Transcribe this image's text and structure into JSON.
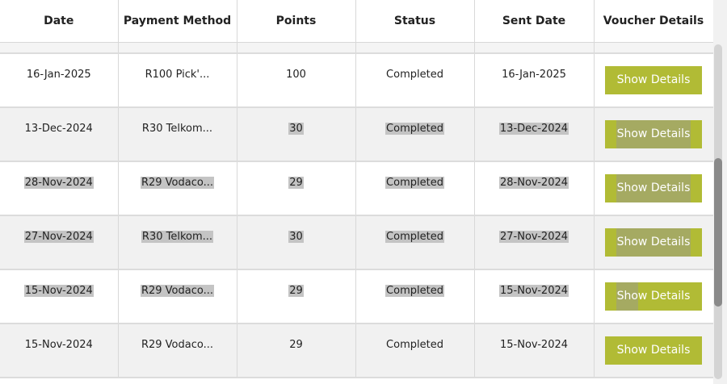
{
  "table": {
    "headers": [
      "Date",
      "Payment Method",
      "Points",
      "Status",
      "Sent Date",
      "Voucher Details"
    ],
    "button_label": "Show Details",
    "rows": [
      {
        "date": "16-Jan-2025",
        "method": "R100 Pick'...",
        "points": "100",
        "status": "Completed",
        "sent": "16-Jan-2025"
      },
      {
        "date": "13-Dec-2024",
        "method": "R30 Telkom...",
        "points": "30",
        "status": "Completed",
        "sent": "13-Dec-2024"
      },
      {
        "date": "28-Nov-2024",
        "method": "R29 Vodaco...",
        "points": "29",
        "status": "Completed",
        "sent": "28-Nov-2024"
      },
      {
        "date": "27-Nov-2024",
        "method": "R30 Telkom...",
        "points": "30",
        "status": "Completed",
        "sent": "27-Nov-2024"
      },
      {
        "date": "15-Nov-2024",
        "method": "R29 Vodaco...",
        "points": "29",
        "status": "Completed",
        "sent": "15-Nov-2024"
      },
      {
        "date": "15-Nov-2024",
        "method": "R29 Vodaco...",
        "points": "29",
        "status": "Completed",
        "sent": "15-Nov-2024"
      }
    ]
  },
  "colors": {
    "button": "#b1bb35",
    "selection": "#c4c4c4",
    "row_alt": "#f1f1f1"
  }
}
